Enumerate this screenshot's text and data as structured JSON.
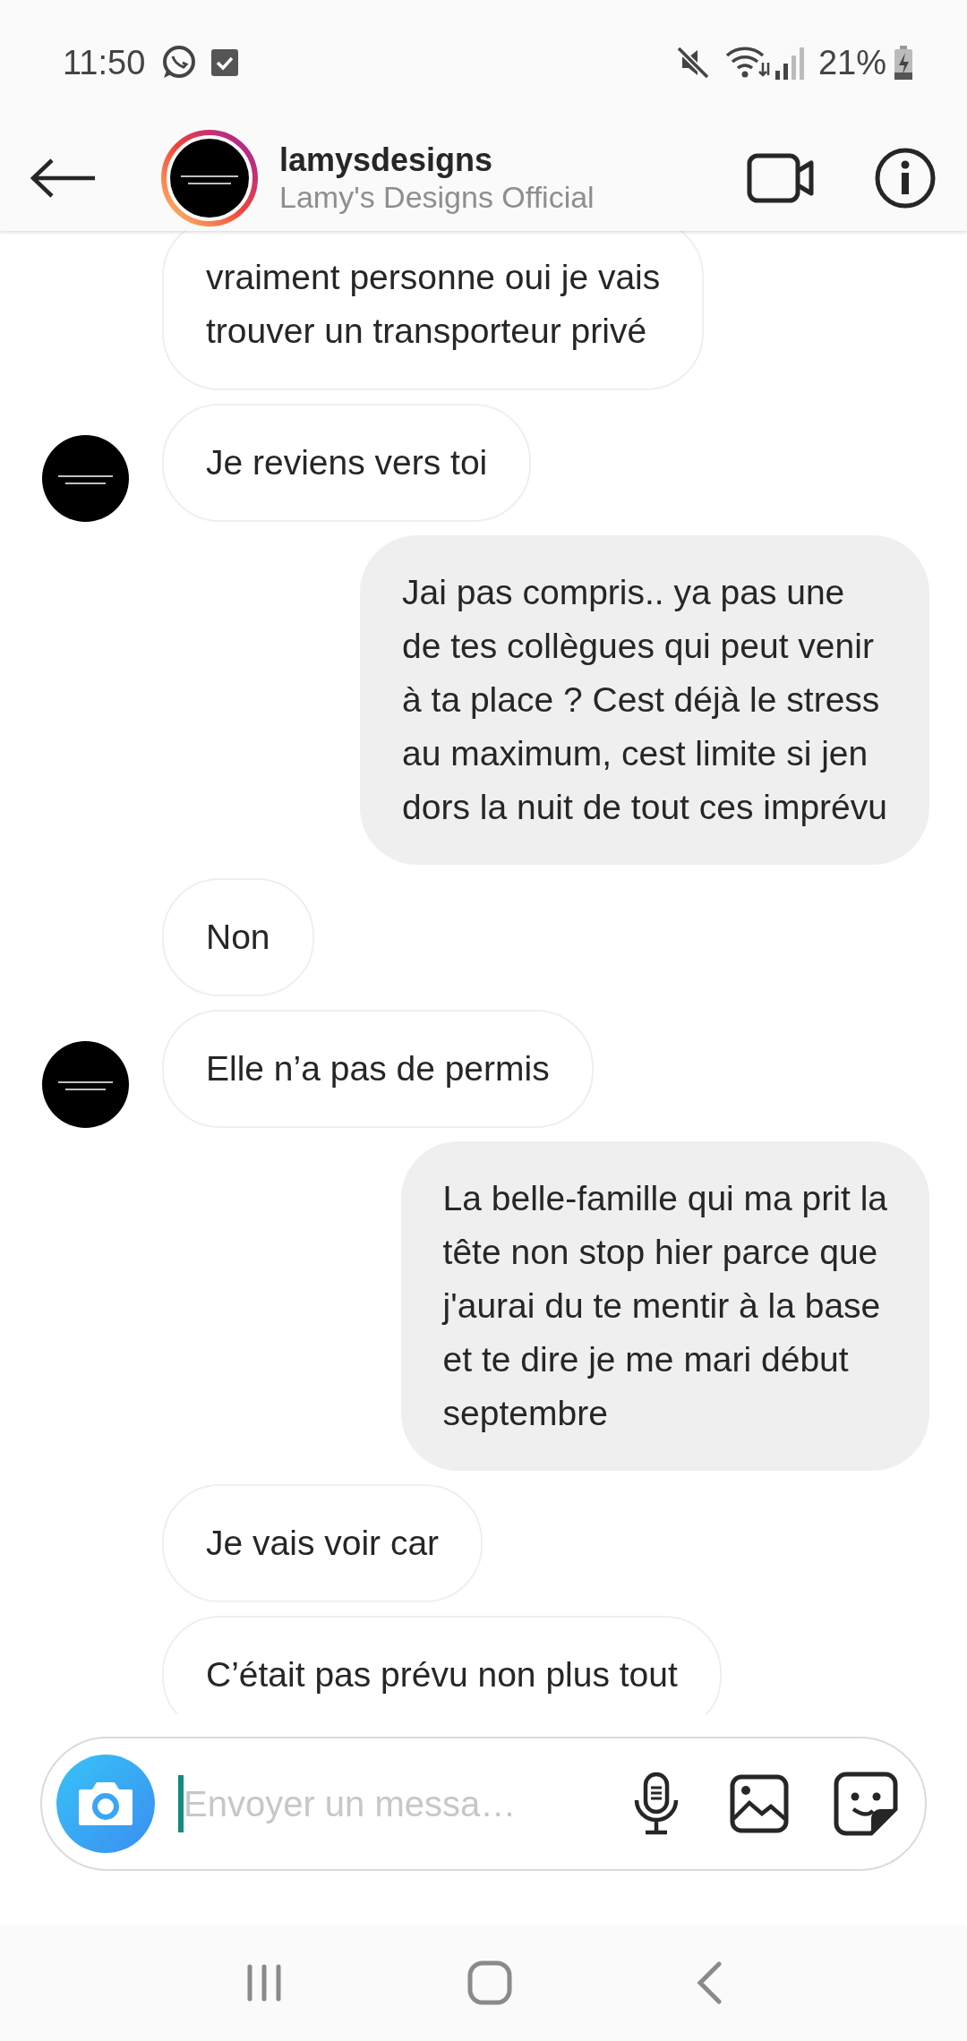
{
  "status_bar": {
    "time": "11:50",
    "battery": "21%"
  },
  "header": {
    "username": "lamysdesigns",
    "subtitle": "Lamy's Designs Official"
  },
  "messages": [
    {
      "kind": "received",
      "avatar": false,
      "text": "vraiment personne oui je vais\ntrouver un transporteur privé"
    },
    {
      "kind": "received",
      "avatar": true,
      "text": "Je reviens vers toi"
    },
    {
      "kind": "sent",
      "avatar": false,
      "text": "Jai pas compris.. ya pas une\nde tes collègues qui peut venir\nà ta place ? Cest déjà le stress\nau maximum, cest limite si jen\ndors la nuit de tout ces imprévu"
    },
    {
      "kind": "received",
      "avatar": false,
      "text": "Non"
    },
    {
      "kind": "received",
      "avatar": true,
      "text": "Elle n’a pas de permis"
    },
    {
      "kind": "sent",
      "avatar": false,
      "text": "La belle-famille qui ma prit la\ntête non stop hier parce que\nj'aurai du te mentir à la base\net te dire je me mari début\nseptembre"
    },
    {
      "kind": "received",
      "avatar": false,
      "text": "Je vais voir car"
    },
    {
      "kind": "received",
      "avatar": false,
      "text": "C’était pas prévu non plus tout"
    }
  ],
  "composer": {
    "placeholder": "Envoyer un messa…"
  }
}
